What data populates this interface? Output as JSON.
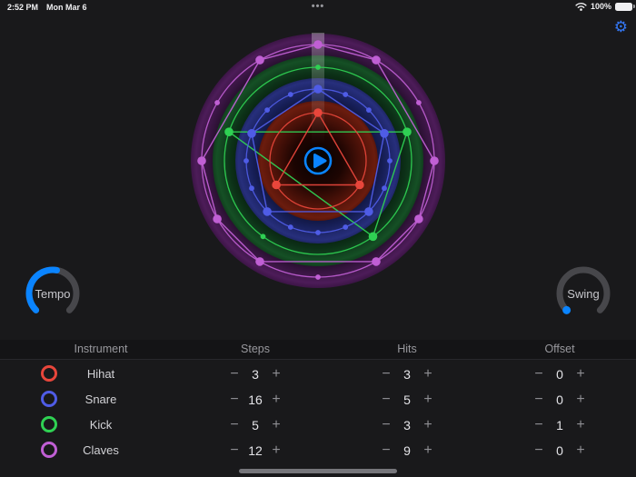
{
  "status_bar": {
    "time": "2:52 PM",
    "date": "Mon Mar 6",
    "menu_dots": "•••",
    "battery_pct": "100%"
  },
  "colors": {
    "accent_blue": "#0a84ff",
    "settings_blue": "#3478f6",
    "knob_track": "#47474b",
    "background": "#19191b"
  },
  "settings": {
    "gear_icon": "⚙"
  },
  "sequencer": {
    "play_icon": "play-triangle",
    "playhead_position": "top",
    "rings": [
      {
        "instrument": "Hihat",
        "steps": 3,
        "hit_steps": [
          0,
          1,
          2
        ],
        "dot_radius": 53,
        "band_radius": 66,
        "color": "#e8463b",
        "band_stops": [
          [
            0,
            "#050000"
          ],
          [
            0.42,
            "#1d0502"
          ],
          [
            0.78,
            "#54140a"
          ],
          [
            0.95,
            "#6b1c0e"
          ],
          [
            1,
            "#5a160b"
          ]
        ]
      },
      {
        "instrument": "Snare",
        "steps": 16,
        "hit_steps": [
          0,
          3,
          6,
          10,
          13
        ],
        "dot_radius": 79,
        "band_radius": 91,
        "color": "#4f5ce6",
        "band_stops": [
          [
            0.6,
            "#0a0d28"
          ],
          [
            0.8,
            "#171f58"
          ],
          [
            0.96,
            "#272f7c"
          ],
          [
            1,
            "#1f2768"
          ]
        ]
      },
      {
        "instrument": "Kick",
        "steps": 5,
        "hit_steps": [
          1,
          2,
          4
        ],
        "dot_radius": 103,
        "band_radius": 116,
        "color": "#2fd153",
        "band_stops": [
          [
            0.68,
            "#05170a"
          ],
          [
            0.83,
            "#0c3017"
          ],
          [
            0.96,
            "#155025"
          ],
          [
            1,
            "#113f1e"
          ]
        ]
      },
      {
        "instrument": "Claves",
        "steps": 12,
        "hit_steps": [
          0,
          1,
          3,
          4,
          5,
          7,
          8,
          9,
          11
        ],
        "dot_radius": 128,
        "band_radius": 140,
        "color": "#c05fd4",
        "band_stops": [
          [
            0.76,
            "#150a19"
          ],
          [
            0.86,
            "#33133c"
          ],
          [
            0.96,
            "#4d1c59"
          ],
          [
            1,
            "#3c1546"
          ]
        ]
      }
    ]
  },
  "knobs": {
    "tempo": {
      "label": "Tempo",
      "arc_start_deg": 225,
      "arc_end_deg": 135,
      "value_end_deg": 10
    },
    "swing": {
      "label": "Swing",
      "arc_start_deg": 225,
      "arc_end_deg": 135,
      "value_end_deg": 226
    }
  },
  "table": {
    "headers": {
      "instrument": "Instrument",
      "steps": "Steps",
      "hits": "Hits",
      "offset": "Offset"
    },
    "stepper": {
      "minus": "−",
      "plus": "+"
    },
    "rows": [
      {
        "name": "Hihat",
        "color": "#e8463b",
        "steps": "3",
        "hits": "3",
        "offset": "0"
      },
      {
        "name": "Snare",
        "color": "#4f5ce6",
        "steps": "16",
        "hits": "5",
        "offset": "0"
      },
      {
        "name": "Kick",
        "color": "#2fd153",
        "steps": "5",
        "hits": "3",
        "offset": "1"
      },
      {
        "name": "Claves",
        "color": "#c05fd4",
        "steps": "12",
        "hits": "9",
        "offset": "0"
      }
    ]
  }
}
